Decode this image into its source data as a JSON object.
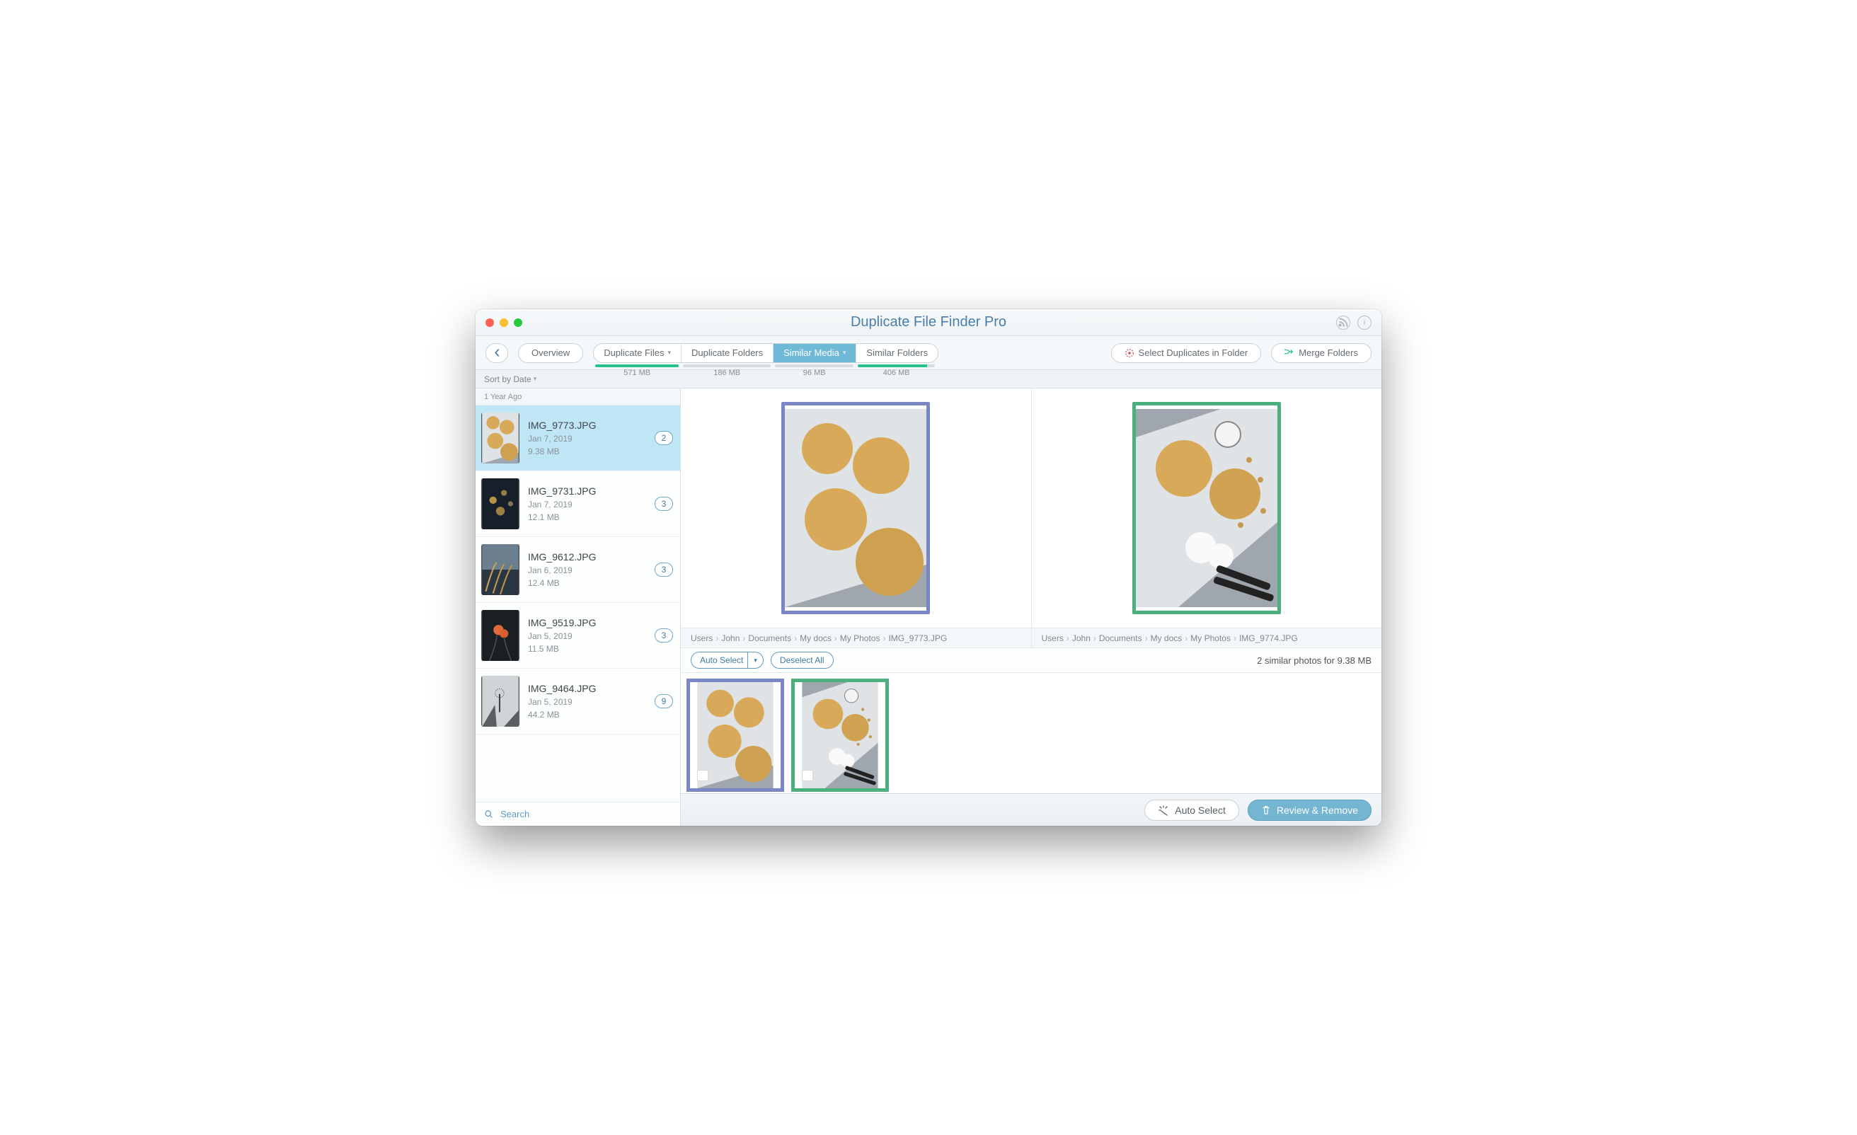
{
  "window": {
    "title": "Duplicate File Finder Pro"
  },
  "toolbar": {
    "overview": "Overview",
    "segments": [
      {
        "label": "Duplicate Files",
        "dropdown": true,
        "size": "571 MB",
        "fill": 100
      },
      {
        "label": "Duplicate Folders",
        "dropdown": false,
        "size": "186 MB",
        "fill": 0
      },
      {
        "label": "Similar Media",
        "dropdown": true,
        "size": "96 MB",
        "fill": 0,
        "active": true
      },
      {
        "label": "Similar Folders",
        "dropdown": false,
        "size": "406 MB",
        "fill": 90
      }
    ],
    "select_in_folder": "Select Duplicates in Folder",
    "merge_folders": "Merge Folders"
  },
  "sort": {
    "label": "Sort by Date"
  },
  "sidebar": {
    "section": "1 Year Ago",
    "items": [
      {
        "name": "IMG_9773.JPG",
        "date": "Jan 7, 2019",
        "size": "9.38 MB",
        "count": "2",
        "selected": true,
        "variant": 1
      },
      {
        "name": "IMG_9731.JPG",
        "date": "Jan 7, 2019",
        "size": "12.1 MB",
        "count": "3",
        "variant": 2
      },
      {
        "name": "IMG_9612.JPG",
        "date": "Jan 6, 2019",
        "size": "12.4 MB",
        "count": "3",
        "variant": 3
      },
      {
        "name": "IMG_9519.JPG",
        "date": "Jan 5, 2019",
        "size": "11.5 MB",
        "count": "3",
        "variant": 4
      },
      {
        "name": "IMG_9464.JPG",
        "date": "Jan 5, 2019",
        "size": "44.2 MB",
        "count": "9",
        "variant": 5
      }
    ],
    "search": "Search"
  },
  "preview": {
    "left": {
      "path": [
        "Users",
        "John",
        "Documents",
        "My docs",
        "My Photos",
        "IMG_9773.JPG"
      ]
    },
    "right": {
      "path": [
        "Users",
        "John",
        "Documents",
        "My docs",
        "My Photos",
        "IMG_9774.JPG"
      ]
    }
  },
  "midbar": {
    "auto_select": "Auto Select",
    "deselect_all": "Deselect All",
    "summary": "2 similar photos for 9.38 MB"
  },
  "footer": {
    "auto_select": "Auto Select",
    "review_remove": "Review & Remove"
  }
}
